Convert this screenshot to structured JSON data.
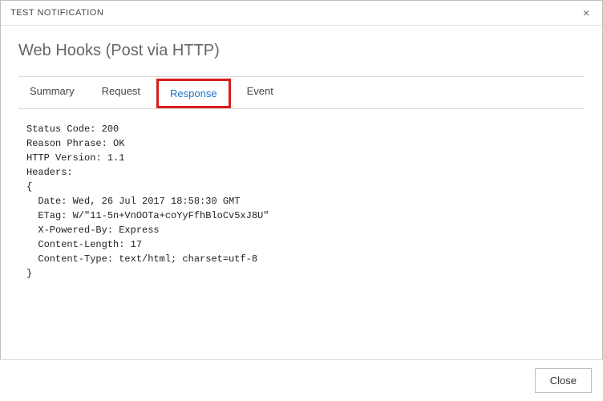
{
  "header": {
    "title": "TEST NOTIFICATION",
    "close_symbol": "×"
  },
  "page": {
    "title": "Web Hooks (Post via HTTP)"
  },
  "tabs": {
    "summary": "Summary",
    "request": "Request",
    "response": "Response",
    "event": "Event"
  },
  "response": {
    "body": "Status Code: 200\nReason Phrase: OK\nHTTP Version: 1.1\nHeaders:\n{\n  Date: Wed, 26 Jul 2017 18:58:30 GMT\n  ETag: W/\"11-5n+VnOOTa+coYyFfhBloCv5xJ8U\"\n  X-Powered-By: Express\n  Content-Length: 17\n  Content-Type: text/html; charset=utf-8\n}"
  },
  "footer": {
    "close_label": "Close"
  }
}
